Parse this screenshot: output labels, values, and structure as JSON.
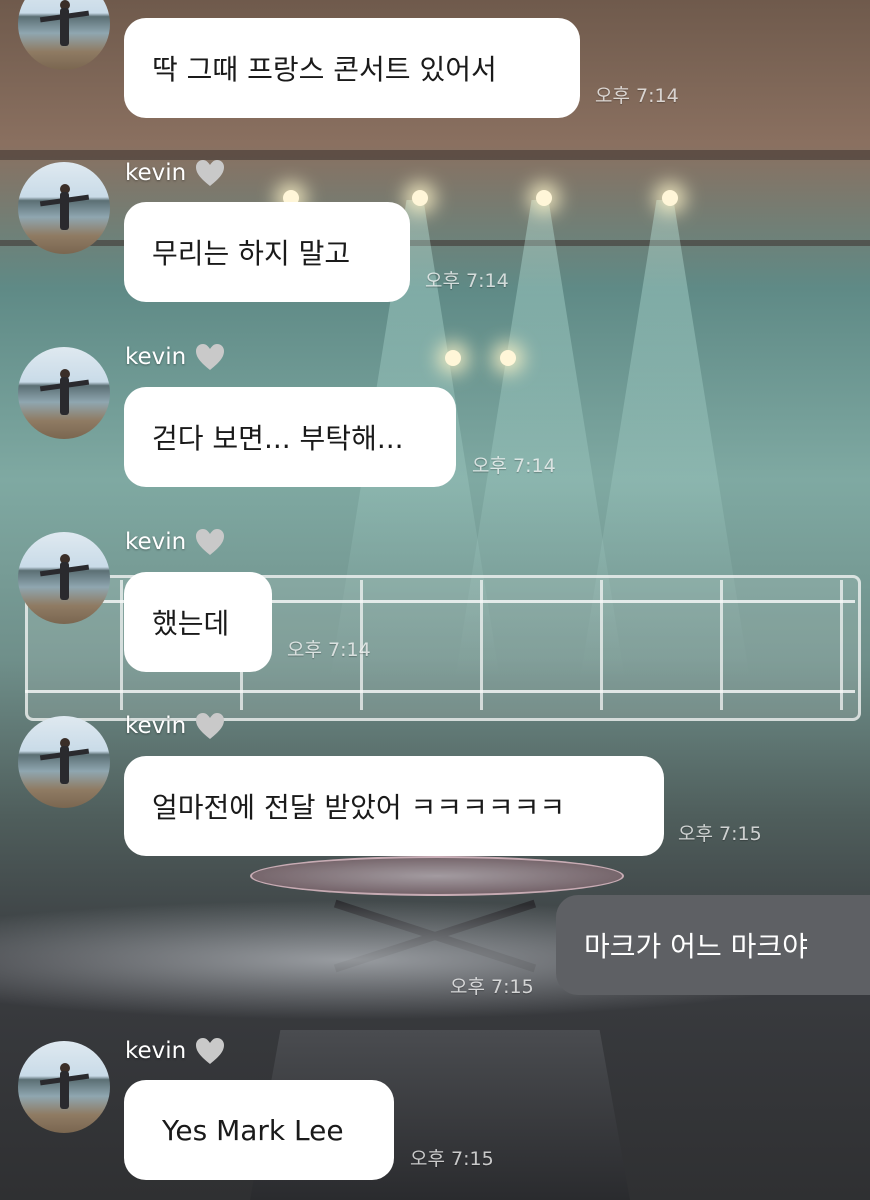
{
  "messages": [
    {
      "sender": "",
      "text": "딱 그때 프랑스 콘서트 있어서",
      "time": "오후 7:14"
    },
    {
      "sender": "kevin",
      "text": "무리는 하지 말고",
      "time": "오후 7:14"
    },
    {
      "sender": "kevin",
      "text": "걷다 보면... 부탁해...",
      "time": "오후 7:14"
    },
    {
      "sender": "kevin",
      "text": "했는데",
      "time": "오후 7:14"
    },
    {
      "sender": "kevin",
      "text": "얼마전에 전달 받았어 ㅋㅋㅋㅋㅋㅋ",
      "time": "오후 7:15"
    },
    {
      "sender": "me",
      "text": "마크가 어느 마크야",
      "time": "오후 7:15"
    },
    {
      "sender": "kevin",
      "text": "Yes Mark Lee",
      "time": "오후 7:15"
    }
  ],
  "icons": {
    "heart": "gray-heart-icon",
    "avatar": "profile-avatar"
  },
  "colors": {
    "incoming_bubble": "#ffffff",
    "outgoing_bubble": "#5e6064",
    "heart": "#c9c9c9"
  }
}
